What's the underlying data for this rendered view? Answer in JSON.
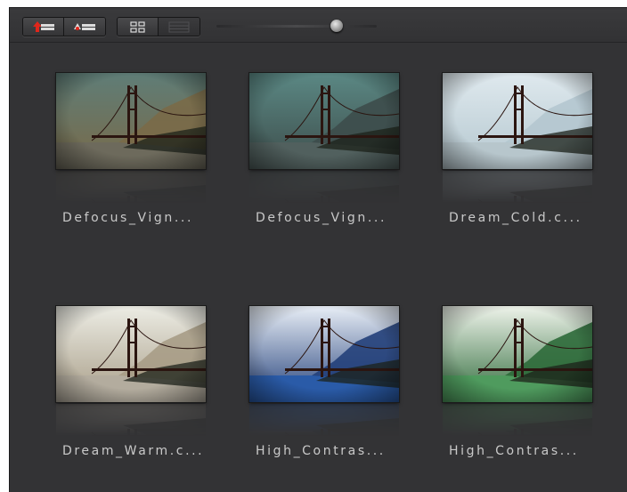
{
  "toolbar": {
    "buttons": [
      {
        "icon": "import-preset-icon"
      },
      {
        "icon": "manage-presets-icon"
      },
      {
        "icon": "grid-view-icon"
      },
      {
        "icon": "list-view-icon"
      }
    ],
    "zoom_slider": {
      "value": 0.75
    }
  },
  "presets": [
    {
      "label": "Defocus_Vign...",
      "tint": "#7a6a48",
      "sky": "#5f7d77",
      "water": "#6d6a5c"
    },
    {
      "label": "Defocus_Vign...",
      "tint": "#3d4d4b",
      "sky": "#5b8884",
      "water": "#51605e"
    },
    {
      "label": "Dream_Cold.c...",
      "tint": "#b4c7cf",
      "sky": "#dfe9ee",
      "water": "#b7c6cc"
    },
    {
      "label": "Dream_Warm.c...",
      "tint": "#a79c86",
      "sky": "#ecece4",
      "water": "#b3ac9e"
    },
    {
      "label": "High_Contras...",
      "tint": "#23407a",
      "sky": "#e8eef6",
      "water": "#2a5ba8"
    },
    {
      "label": "High_Contras...",
      "tint": "#2e6a3a",
      "sky": "#eef3ea",
      "water": "#4f9b5e"
    }
  ]
}
